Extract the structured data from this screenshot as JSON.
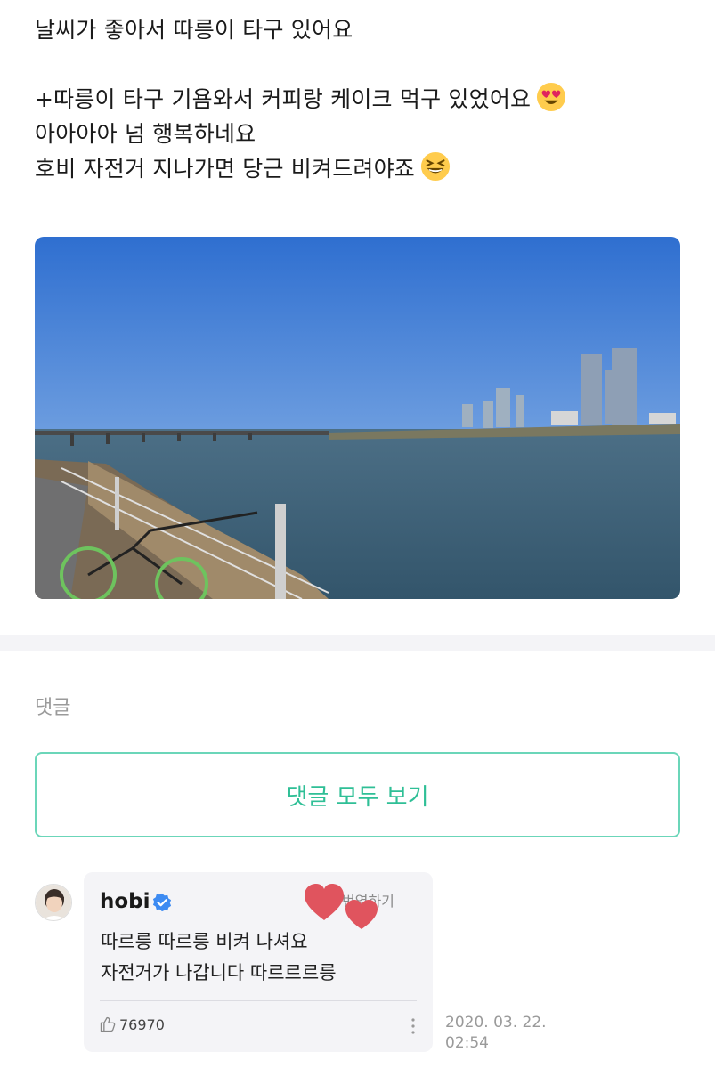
{
  "post": {
    "lines": [
      "날씨가 좋아서 따릉이 타구 있어요",
      "",
      "+따릉이 타구 기욤와서 커피랑 케이크 먹구 있었어요",
      "아아아아 넘 행복하네요",
      "호비 자전거 지나가면 당근 비켜드려야죠"
    ],
    "emoji_line3": "heart-eyes-emoji",
    "emoji_line5": "grinning-squinting-emoji"
  },
  "comments": {
    "section_label": "댓글",
    "view_all_label": "댓글 모두 보기",
    "accent_color": "#2fbf96"
  },
  "reply": {
    "author": "hobi",
    "translate_label": "번역하기",
    "line1": "따르릉 따르릉 비켜 나셔요",
    "line2": "자전거가 나갑니다 따르르르릉",
    "likes": "76970",
    "date": "2020. 03. 22.",
    "time": "02:54"
  }
}
